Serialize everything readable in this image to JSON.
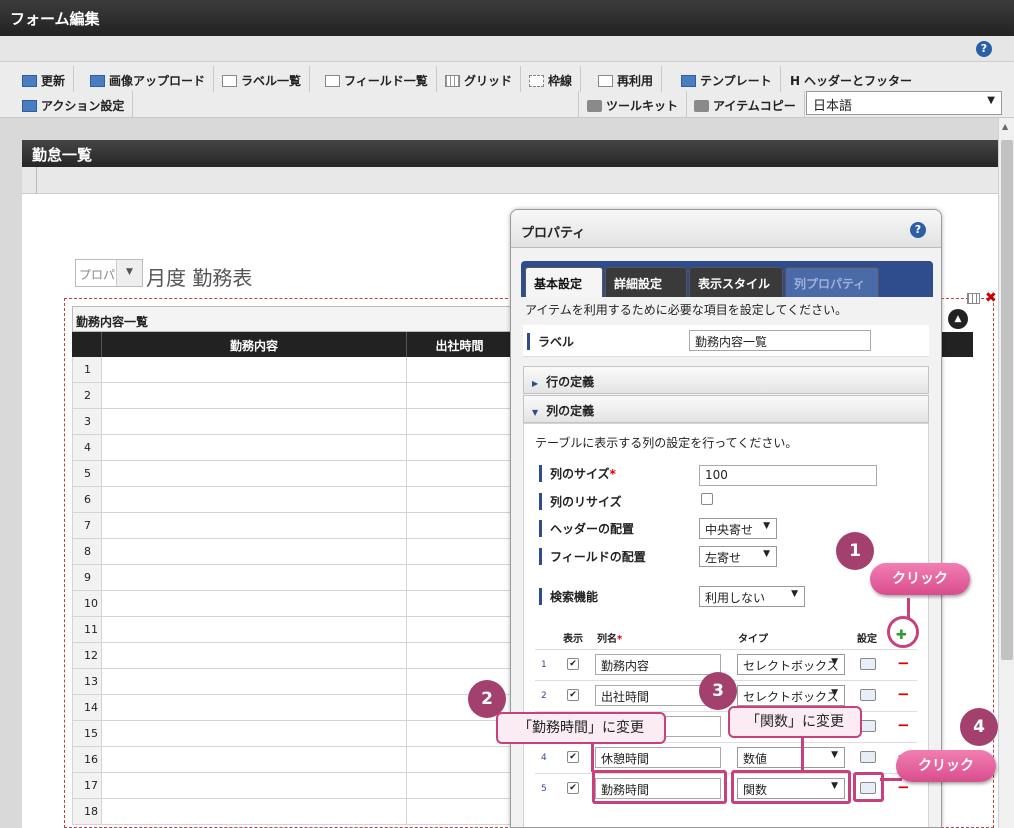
{
  "window": {
    "title": "フォーム編集"
  },
  "help_icon": "?",
  "toolbar": {
    "row1": [
      {
        "label": "更新",
        "icon": "refresh-icon"
      },
      {
        "label": "画像アップロード",
        "icon": "image-upload-icon"
      },
      {
        "label": "ラベル一覧",
        "icon": "label-list-icon"
      },
      {
        "label": "フィールド一覧",
        "icon": "field-list-icon"
      },
      {
        "label": "グリッド",
        "icon": "grid-icon"
      },
      {
        "label": "枠線",
        "icon": "border-icon"
      },
      {
        "label": "再利用",
        "icon": "reuse-icon"
      },
      {
        "label": "テンプレート",
        "icon": "template-icon"
      },
      {
        "label": "ヘッダーとフッター",
        "icon": "header-footer-icon"
      }
    ],
    "row2": [
      {
        "label": "アクション設定",
        "icon": "action-icon"
      },
      {
        "label": "ツールキット",
        "icon": "toolkit-icon"
      },
      {
        "label": "アイテムコピー",
        "icon": "item-copy-icon"
      }
    ],
    "language": "日本語"
  },
  "form": {
    "title": "勤怠一覧",
    "month_placeholder": "プロパ",
    "month_suffix": "月度 勤務表",
    "table": {
      "caption": "勤務内容一覧",
      "headers": [
        "勤務内容",
        "出社時間"
      ],
      "row_numbers": [
        "1",
        "2",
        "3",
        "4",
        "5",
        "6",
        "7",
        "8",
        "9",
        "10",
        "11",
        "12",
        "13",
        "14",
        "15",
        "16",
        "17",
        "18"
      ]
    }
  },
  "properties": {
    "title": "プロパティ",
    "tabs": [
      "基本設定",
      "詳細設定",
      "表示スタイル",
      "列プロパティ"
    ],
    "active_tab": "基本設定",
    "description": "アイテムを利用するために必要な項目を設定してください。",
    "label_caption": "ラベル",
    "label_value": "勤務内容一覧",
    "row_section": "行の定義",
    "col_section": "列の定義",
    "col_description": "テーブルに表示する列の設定を行ってください。",
    "col_size_label": "列のサイズ",
    "required_mark": "*",
    "col_size_value": "100",
    "col_resize_label": "列のリサイズ",
    "col_resize_checked": false,
    "header_align_label": "ヘッダーの配置",
    "header_align_value": "中央寄せ",
    "field_align_label": "フィールドの配置",
    "field_align_value": "左寄せ",
    "search_label": "検索機能",
    "search_value": "利用しない",
    "col_table": {
      "headers": {
        "show": "表示",
        "name": "列名",
        "type": "タイプ",
        "setting": "設定"
      },
      "rows": [
        {
          "no": "1",
          "checked": true,
          "name": "勤務内容",
          "type": "セレクトボックス"
        },
        {
          "no": "2",
          "checked": true,
          "name": "出社時間",
          "type": "セレクトボックス"
        },
        {
          "no": "3",
          "checked": true,
          "name": "",
          "type": ""
        },
        {
          "no": "4",
          "checked": true,
          "name": "休憩時間",
          "type": "数値"
        },
        {
          "no": "5",
          "checked": true,
          "name": "勤務時間",
          "type": "関数"
        }
      ]
    }
  },
  "annotations": {
    "badges": [
      "1",
      "2",
      "3",
      "4"
    ],
    "click": "クリック",
    "change_name": "「勤務時間」に変更",
    "change_type": "「関数」に変更"
  },
  "colors": {
    "accent": "#c8407e",
    "tab_bar": "#2f4d8d",
    "title_bar": "#2b2b2b"
  }
}
